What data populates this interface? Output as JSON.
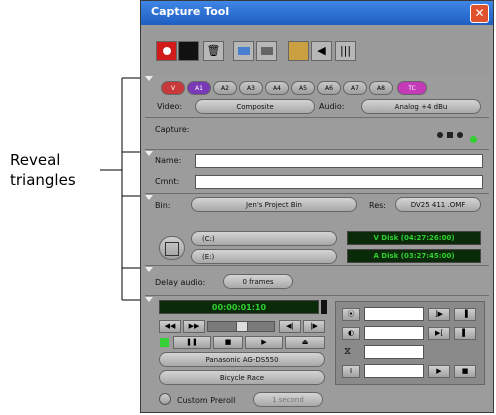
{
  "callout": {
    "line1": "Reveal",
    "line2": "triangles"
  },
  "window": {
    "title": "Capture Tool",
    "close": "✕"
  },
  "toolbar": {
    "record_icon": "record-icon",
    "trash_icon": "trash-icon",
    "audio_icon": "speaker-icon",
    "meter_icon": "meter-icon"
  },
  "tracks": [
    "V",
    "A1",
    "A2",
    "A3",
    "A4",
    "A5",
    "A6",
    "A7",
    "A8",
    "TC"
  ],
  "inputs": {
    "video_label": "Video:",
    "video_value": "Composite",
    "audio_label": "Audio:",
    "audio_value": "Analog +4 dBu"
  },
  "capture": {
    "label": "Capture:"
  },
  "clip": {
    "name_label": "Name:",
    "cmnt_label": "Cmnt:"
  },
  "bin": {
    "label": "Bin:",
    "value": "Jen's Project Bin",
    "res_label": "Res:",
    "res_value": "DV25 411 .OMF"
  },
  "disks": {
    "video_drive": "(C:)",
    "audio_drive": "(E:)",
    "video_disk": "V Disk (04:27:26:00)",
    "audio_disk": "A Disk (03:27:45:00)"
  },
  "delay": {
    "label": "Delay audio:",
    "value": "0 frames"
  },
  "deck": {
    "timecode": "00:00:01:10",
    "deck_name": "Panasonic AG-DS550",
    "tape_name": "Bicycle Race",
    "preroll_label": "Custom Preroll",
    "preroll_value": "1 second"
  }
}
